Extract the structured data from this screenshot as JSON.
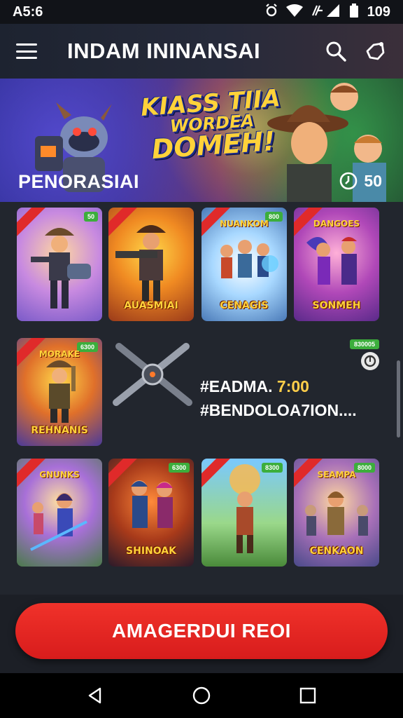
{
  "status_bar": {
    "time": "A5:6",
    "battery": "109",
    "icons": [
      "alarm-icon",
      "wifi-icon",
      "signal-icon",
      "battery-icon"
    ]
  },
  "app_bar": {
    "title": "INDAM ININANSAI",
    "icons": [
      "menu-icon",
      "search-icon",
      "share-icon"
    ]
  },
  "banner": {
    "headline_line1": "KIASS TIIA",
    "headline_line2": "WORDEA",
    "headline_line3": "DOMEH!"
  },
  "section": {
    "title": "PENORASIAI",
    "count": "50"
  },
  "grid_row1": [
    {
      "badge": "50",
      "label": ""
    },
    {
      "badge": "",
      "label": "AUASMIAI"
    },
    {
      "badge": "800",
      "top_label": "NUANKOM",
      "label": "CENAGIS"
    },
    {
      "badge": "",
      "top_label": "DANGOES",
      "label": "SONMEH"
    }
  ],
  "grid_row2": {
    "card_badge": "6300",
    "card_top_label": "MORAKE",
    "card_label": "REHNANIS"
  },
  "promo": {
    "badge": "830005",
    "line1_prefix": "#EADMA.",
    "line1_highlight": "7:00",
    "line2": "#BENDOLOA7ION...."
  },
  "grid_row3": [
    {
      "badge": "",
      "top_label": "GNUNKS",
      "label": ""
    },
    {
      "badge": "6300",
      "label": "SHINOAK"
    },
    {
      "badge": "8300",
      "label": ""
    },
    {
      "badge": "8000",
      "top_label": "SEAMPA",
      "label": "CENKAON"
    }
  ],
  "cta": {
    "label": "AMAGERDUI REOI"
  },
  "nav_bar": {
    "icons": [
      "back-icon",
      "home-icon",
      "recents-icon"
    ]
  },
  "colors": {
    "accent_red": "#e8261f",
    "badge_green": "#3cae3c",
    "highlight_yellow": "#ffce4a"
  }
}
